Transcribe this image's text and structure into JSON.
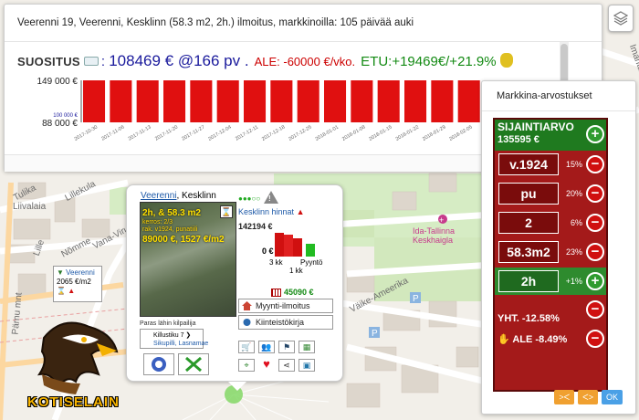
{
  "map": {
    "streets": [
      "Tulika",
      "Lillekula",
      "Liivalaia",
      "Vana-Viru",
      "Nõmme",
      "Imanta",
      "Pärnu mnt",
      "Väike-Ameerika",
      "Lille"
    ],
    "hospital_label": "Ida-Tallinna Keskhaigla",
    "colors": {
      "bg": "#f2efe9",
      "road": "#ffffff",
      "major_road": "#fdd49a",
      "building": "#ddd6cc",
      "park": "#c8e6b0"
    }
  },
  "top_panel": {
    "header": "Veerenni 19, Veerenni, Kesklinn (58.3 m2, 2h.) ilmoitus, markkinoilla: 105 päivää auki",
    "suositus_label": "SUOSITUS",
    "price_main": "108469 € @166 pv .",
    "price_ale": "ALE: -60000 €/vko.",
    "price_etu": "ETU:+19469€/+21.9%",
    "chart_data": {
      "type": "bar",
      "y_labels": [
        "149 000 €",
        "100 000 €",
        "88 000 €"
      ],
      "ylim": [
        88000,
        149000
      ],
      "categories": [
        "2017-10-30",
        "2017-11-06",
        "2017-11-13",
        "2017-11-20",
        "2017-11-27",
        "2017-12-04",
        "2017-12-11",
        "2017-12-18",
        "2017-12-25",
        "2018-01-01",
        "2018-01-08",
        "2018-01-15",
        "2018-01-22",
        "2018-01-29",
        "2018-02-05"
      ],
      "values": [
        149000,
        149000,
        149000,
        149000,
        149000,
        149000,
        149000,
        149000,
        149000,
        149000,
        149000,
        149000,
        149000,
        149000,
        149000
      ],
      "color": "#e01010"
    }
  },
  "market": {
    "title": "Markkina-arvostukset",
    "sijainti_label": "SIJAINTIARVO",
    "sijainti_value": "135595 €",
    "rows": [
      {
        "pic": "v.1924",
        "pct": "15%",
        "type": "minus"
      },
      {
        "pic": "pu",
        "pct": "20%",
        "type": "minus"
      },
      {
        "pic": "2",
        "pct": "6%",
        "type": "minus"
      },
      {
        "pic": "58.3m2",
        "pct": "23%",
        "type": "minus"
      },
      {
        "pic": "2h",
        "pct": "+1%",
        "type": "plus"
      }
    ],
    "yht": "YHT. -12.58%",
    "ale": "ALE -8.49%",
    "buttons": [
      ">ᐸ",
      "ᐸ>",
      "OK"
    ]
  },
  "popup": {
    "title_link": "Veerenni",
    "title_rest": ", Kesklinn",
    "photo_line1": "2h, & 58.3 m2",
    "photo_line2": "kerros: 2/3",
    "photo_line3": "rak. v1924, punatiili",
    "photo_line4": "89000 €, 1527 €/m2",
    "kh_label": "Kesklinn hinnat",
    "kh_price": "142194 €",
    "kh_zero": "0 €",
    "kh_x1": "3 kk",
    "kh_x2": "Pyyntö",
    "kh_x3": "1 kk",
    "kh_bottom": "45090 €",
    "btn_myynti": "Myynti-ilmoitus",
    "btn_kiinteisto": "Kiinteistökirja",
    "paras": "Paras lähin kilpailija",
    "kill_line1": "Killustiku 7",
    "kill_line2": "Sikupilli, Lasnamae"
  },
  "flag": {
    "name": "Veerenni",
    "price": "2065 €/m2"
  },
  "logo_text": "KOTISELAIN"
}
